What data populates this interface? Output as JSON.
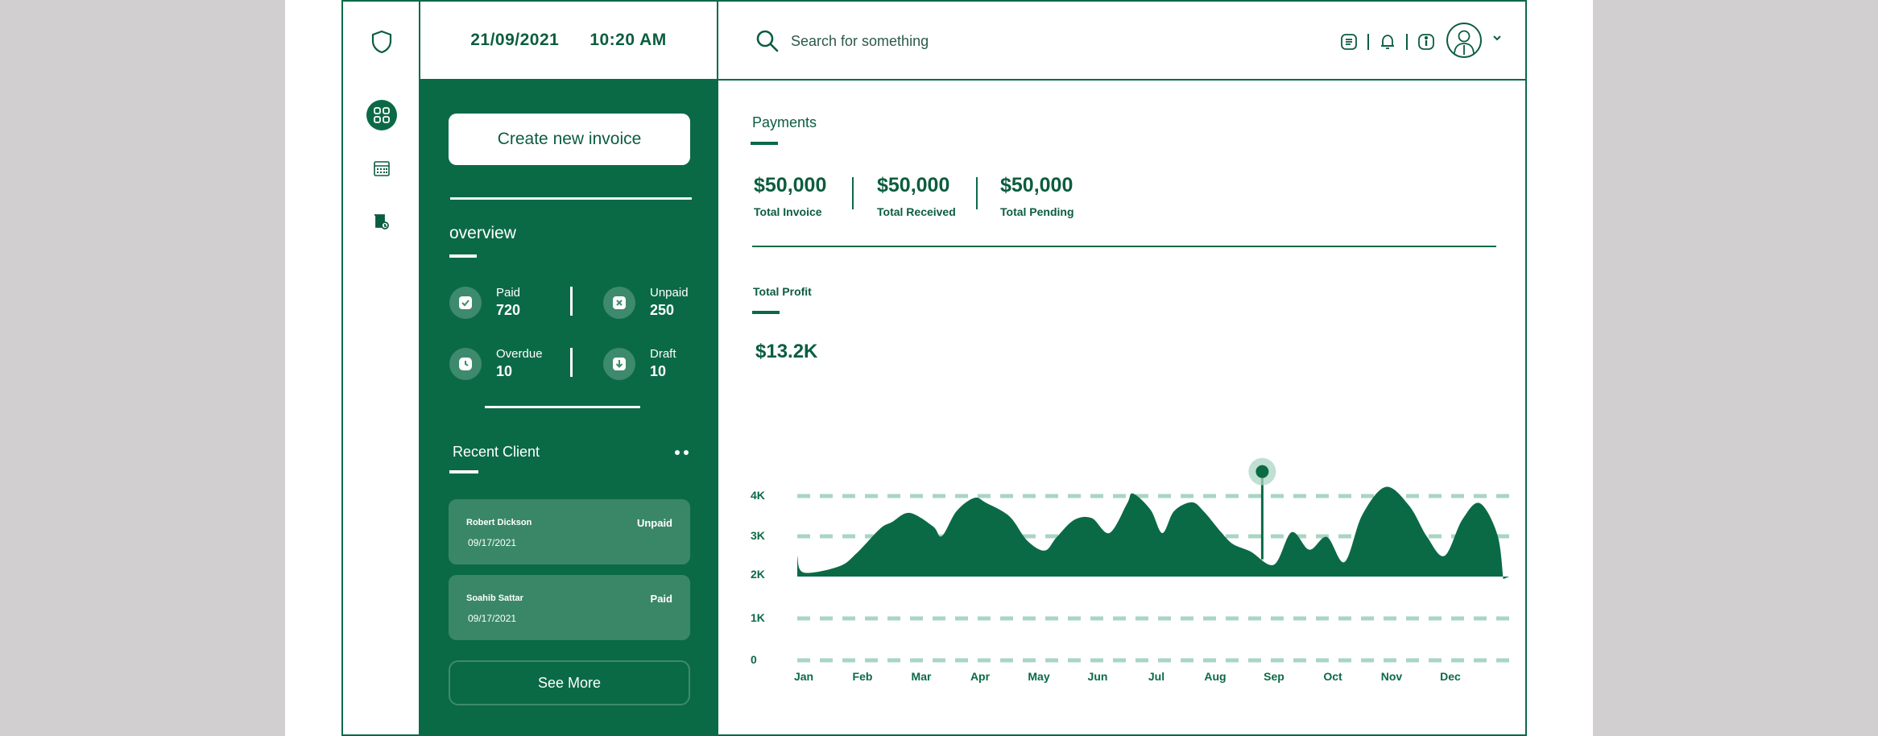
{
  "header": {
    "date": "21/09/2021",
    "time": "10:20 AM",
    "search_placeholder": "Search for something"
  },
  "sidebar": {
    "icons": [
      "shield-icon",
      "dashboard-icon",
      "calendar-icon",
      "document-icon"
    ],
    "active": "dashboard-icon"
  },
  "panel": {
    "create_button": "Create new invoice",
    "overview_title": "overview",
    "stats": [
      {
        "label": "Paid",
        "value": "720",
        "icon": "check-icon"
      },
      {
        "label": "Unpaid",
        "value": "250",
        "icon": "x-icon"
      },
      {
        "label": "Overdue",
        "value": "10",
        "icon": "clock-icon"
      },
      {
        "label": "Draft",
        "value": "10",
        "icon": "download-icon"
      }
    ],
    "recent_title": "Recent Client",
    "clients": [
      {
        "name": "Robert Dickson",
        "status": "Unpaid",
        "date": "09/17/2021"
      },
      {
        "name": "Soahib Sattar",
        "status": "Paid",
        "date": "09/17/2021"
      }
    ],
    "see_more": "See More"
  },
  "payments": {
    "title": "Payments",
    "kpis": [
      {
        "value": "$50,000",
        "label": "Total Invoice"
      },
      {
        "value": "$50,000",
        "label": "Total Received"
      },
      {
        "value": "$50,000",
        "label": "Total Pending"
      }
    ]
  },
  "profit": {
    "title": "Total Profit",
    "value": "$13.2K"
  },
  "colors": {
    "primary": "#0b6a46",
    "panel_card": "#3a8768",
    "gridline": "#a9d5c4",
    "background_gray": "#d1cfd0"
  },
  "chart_data": {
    "type": "area",
    "categories": [
      "Jan",
      "Feb",
      "Mar",
      "Apr",
      "May",
      "Jun",
      "Jul",
      "Aug",
      "Sep",
      "Oct",
      "Nov",
      "Dec"
    ],
    "y_ticks": [
      "0",
      "1K",
      "2K",
      "3K",
      "4K"
    ],
    "ylim": [
      0,
      4000
    ],
    "grid": true,
    "x": [
      -0.2,
      0,
      0.6,
      0.9,
      1.3,
      1.5,
      1.8,
      2.2,
      2.35,
      2.6,
      2.9,
      3.1,
      3.5,
      3.8,
      4.1,
      4.3,
      4.6,
      4.9,
      5.2,
      5.5,
      5.6,
      5.9,
      6.1,
      6.3,
      6.6,
      6.8,
      7.1,
      7.3,
      7.6,
      8.0,
      8.3,
      8.6,
      8.9,
      9.2,
      9.5,
      9.9,
      10.3,
      10.6,
      10.9,
      11.2,
      11.5,
      11.8,
      11.9
    ],
    "values": [
      2380,
      2000,
      2140,
      2440,
      3000,
      3150,
      3360,
      3050,
      2830,
      3400,
      3700,
      3590,
      3280,
      2730,
      2500,
      2800,
      3200,
      3240,
      2900,
      3570,
      3800,
      3430,
      2900,
      3400,
      3600,
      3400,
      2920,
      2650,
      2480,
      2180,
      2920,
      2520,
      2810,
      2240,
      3310,
      3950,
      3520,
      2820,
      2380,
      3200,
      3580,
      2860,
      1850
    ],
    "highlight": {
      "x": 7.8,
      "y": 4300
    }
  }
}
